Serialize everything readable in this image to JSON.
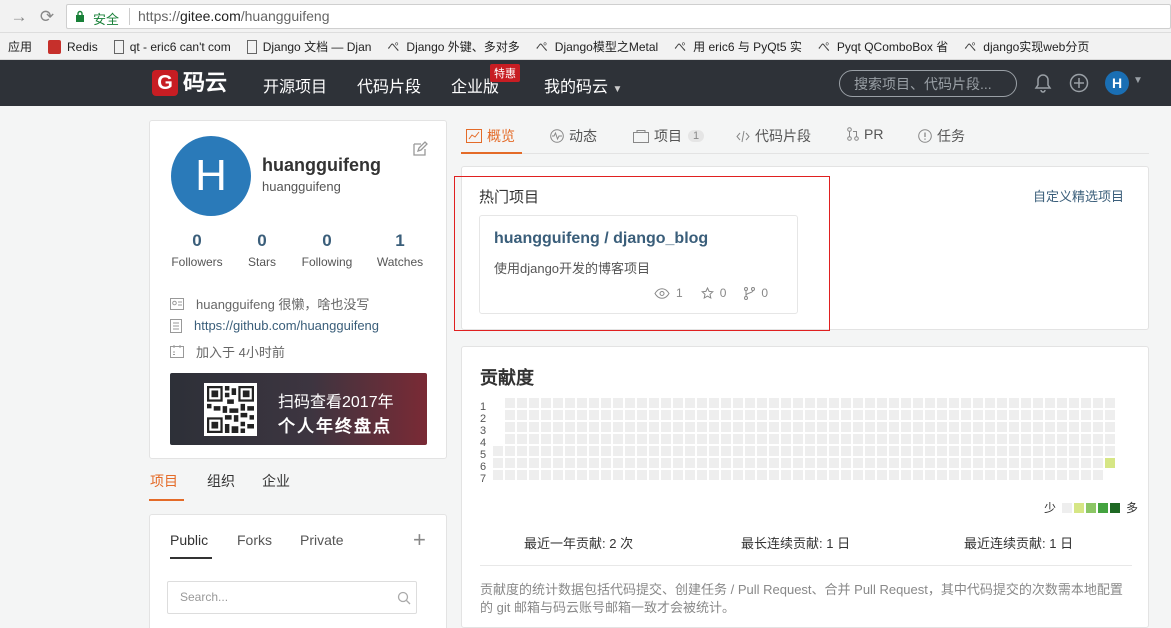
{
  "browser": {
    "secure_label": "安全",
    "url_prefix": "https://",
    "url_host": "gitee.com",
    "url_path": "/huangguifeng",
    "bookmarks": [
      {
        "label": "应用",
        "icon": "apps-icon"
      },
      {
        "label": "Redis",
        "icon": "redis-icon"
      },
      {
        "label": "qt - eric6 can't com",
        "icon": "page-icon"
      },
      {
        "label": "Django 文档 — Djan",
        "icon": "page-icon"
      },
      {
        "label": "Django 外键、多对多",
        "icon": "csdn-icon"
      },
      {
        "label": "Django模型之Metal",
        "icon": "csdn-icon"
      },
      {
        "label": "用 eric6 与 PyQt5 实",
        "icon": "csdn-icon"
      },
      {
        "label": "Pyqt QComboBox 省",
        "icon": "csdn-icon"
      },
      {
        "label": "django实现web分页",
        "icon": "csdn-icon"
      }
    ]
  },
  "header": {
    "logo_letter": "G",
    "logo_text": "码云",
    "nav": [
      "开源项目",
      "代码片段",
      "企业版",
      "我的码云"
    ],
    "badge": "特惠",
    "search_placeholder": "搜索项目、代码片段...",
    "avatar_letter": "H"
  },
  "profile": {
    "avatar_letter": "H",
    "display_name": "huangguifeng",
    "username": "huangguifeng",
    "stats": [
      {
        "value": "0",
        "label": "Followers"
      },
      {
        "value": "0",
        "label": "Stars"
      },
      {
        "value": "0",
        "label": "Following"
      },
      {
        "value": "1",
        "label": "Watches"
      }
    ],
    "bio": "huangguifeng 很懒，啥也没写",
    "website": "https://github.com/huangguifeng",
    "joined": "加入于 4小时前",
    "banner_line1": "扫码查看2017年",
    "banner_line2": "个人年终盘点"
  },
  "left_tabs": [
    "项目",
    "组织",
    "企业"
  ],
  "repo_tabs": [
    "Public",
    "Forks",
    "Private"
  ],
  "repo_search_placeholder": "Search...",
  "main_tabs": [
    {
      "label": "概览",
      "icon": "overview-icon"
    },
    {
      "label": "动态",
      "icon": "activity-icon"
    },
    {
      "label": "项目",
      "icon": "project-icon",
      "count": "1"
    },
    {
      "label": "代码片段",
      "icon": "code-icon"
    },
    {
      "label": "PR",
      "icon": "pull-request-icon"
    },
    {
      "label": "任务",
      "icon": "issue-icon"
    }
  ],
  "hot": {
    "title": "热门项目",
    "customize": "自定义精选项目",
    "project": {
      "name": "huangguifeng / django_blog",
      "desc": "使用django开发的博客项目",
      "watches": "1",
      "stars": "0",
      "forks": "0"
    }
  },
  "contrib": {
    "title": "贡献度",
    "day_labels": [
      "1",
      "2",
      "3",
      "4",
      "5",
      "6",
      "7"
    ],
    "legend_less": "少",
    "legend_more": "多",
    "legend_colors": [
      "#eeeeee",
      "#d6e685",
      "#8cc665",
      "#44a340",
      "#1e6823"
    ],
    "empty_color": "#eeeeee",
    "active_color": "#d6e685",
    "stat_year": "最近一年贡献: 2 次",
    "stat_longest": "最长连续贡献: 1 日",
    "stat_recent": "最近连续贡献: 1 日",
    "note": "贡献度的统计数据包括代码提交、创建任务 / Pull Request、合并 Pull Request，其中代码提交的次数需本地配置的 git 邮箱与码云账号邮箱一致才会被统计。"
  }
}
